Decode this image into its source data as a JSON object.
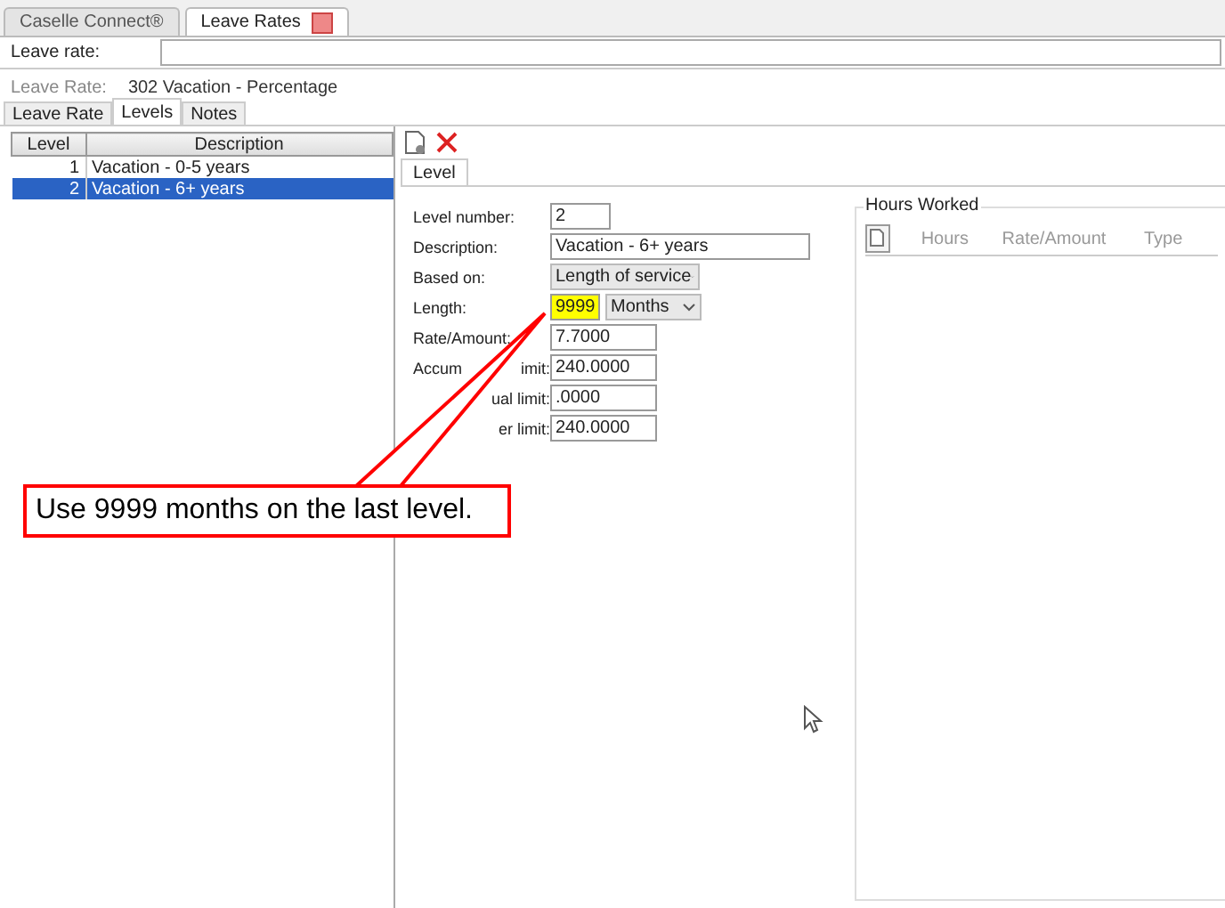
{
  "tabs": [
    {
      "label": "Caselle Connect®",
      "selected": false,
      "closable": false
    },
    {
      "label": "Leave Rates",
      "selected": true,
      "closable": true
    }
  ],
  "leave_rate_field": {
    "label": "Leave rate:"
  },
  "header": {
    "label": "Leave Rate:",
    "value": "302  Vacation - Percentage"
  },
  "subtabs": [
    {
      "label": "Leave Rate",
      "selected": false
    },
    {
      "label": "Levels",
      "selected": true
    },
    {
      "label": "Notes",
      "selected": false
    }
  ],
  "levels_table": {
    "columns": [
      "Level",
      "Description"
    ],
    "rows": [
      {
        "level": "1",
        "description": "Vacation - 0-5 years",
        "selected": false
      },
      {
        "level": "2",
        "description": "Vacation - 6+ years",
        "selected": true
      }
    ]
  },
  "detail_tabs": [
    {
      "label": "Level",
      "selected": true
    }
  ],
  "form": [
    {
      "label_parts": [
        "Level number:"
      ],
      "kind": "short",
      "value": "2"
    },
    {
      "label_parts": [
        "Description:"
      ],
      "kind": "long",
      "value": "Vacation - 6+ years"
    },
    {
      "label_parts": [
        "Based on:"
      ],
      "kind": "select",
      "value": "Length of service"
    },
    {
      "label_parts": [
        "Length:"
      ],
      "kind": "length",
      "value": "9999",
      "unit": "Months",
      "highlighted": true
    },
    {
      "label_parts": [
        "Rate/Amount:"
      ],
      "kind": "number",
      "value": "7.7000"
    },
    {
      "label_parts": [
        "Accum",
        "imit:"
      ],
      "kind": "number",
      "value": "240.0000"
    },
    {
      "label_parts": [
        "ual limit:"
      ],
      "kind": "number",
      "value": ".0000"
    },
    {
      "label_parts": [
        "er limit:"
      ],
      "kind": "number",
      "value": "240.0000"
    }
  ],
  "hours_worked": {
    "title": "Hours Worked",
    "columns": [
      "Hours",
      "Rate/Amount",
      "Type"
    ]
  },
  "callout": {
    "text": "Use 9999 months on the last level."
  }
}
